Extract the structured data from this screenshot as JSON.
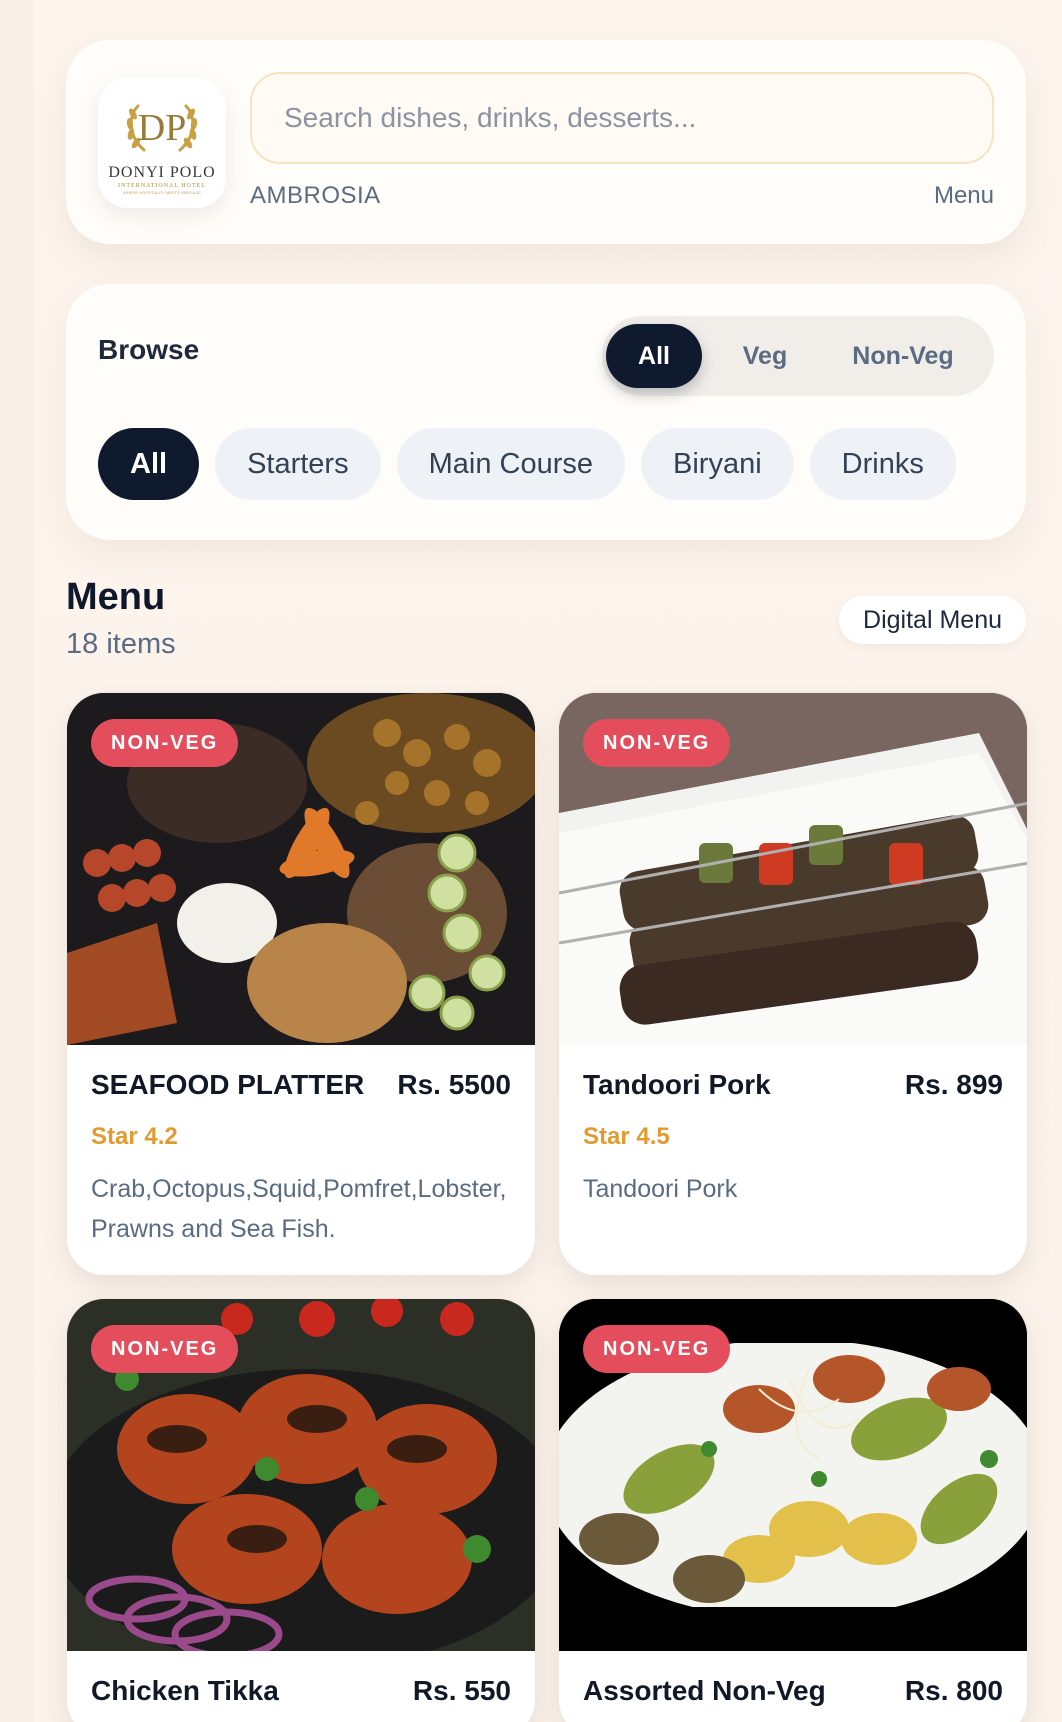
{
  "header": {
    "logo": {
      "monogram": "DP",
      "name": "DONYI POLO",
      "subtitle": "INTERNATIONAL HOTEL",
      "tagline": "WHERE HOSPITALITY MEETS HERITAGE"
    },
    "search_placeholder": "Search dishes, drinks, desserts...",
    "venue": "AMBROSIA",
    "menu_link": "Menu"
  },
  "browse": {
    "title": "Browse",
    "diet_filters": [
      {
        "label": "All",
        "active": true
      },
      {
        "label": "Veg",
        "active": false
      },
      {
        "label": "Non-Veg",
        "active": false
      }
    ],
    "categories": [
      {
        "label": "All",
        "active": true
      },
      {
        "label": "Starters",
        "active": false
      },
      {
        "label": "Main Course",
        "active": false
      },
      {
        "label": "Biryani",
        "active": false
      },
      {
        "label": "Drinks",
        "active": false
      }
    ]
  },
  "menu": {
    "title": "Menu",
    "count": "18 items",
    "digital_menu_label": "Digital Menu",
    "items": [
      {
        "badge": "NON-VEG",
        "name": "SEAFOOD PLATTER",
        "price": "Rs. 5500",
        "rating": "Star 4.2",
        "description": "Crab,Octopus,Squid,Pomfret,Lobster,Prawns and Sea Fish."
      },
      {
        "badge": "NON-VEG",
        "name": "Tandoori Pork",
        "price": "Rs. 899",
        "rating": "Star 4.5",
        "description": "Tandoori Pork"
      },
      {
        "badge": "NON-VEG",
        "name": "Chicken Tikka",
        "price": "Rs. 550",
        "rating": "",
        "description": ""
      },
      {
        "badge": "NON-VEG",
        "name": "Assorted Non-Veg",
        "price": "Rs. 800",
        "rating": "",
        "description": ""
      }
    ]
  },
  "colors": {
    "accent_dark": "#0f1a2e",
    "badge_red": "#e44d5c",
    "rating_orange": "#e39a2f",
    "muted_text": "#5b6b82"
  }
}
